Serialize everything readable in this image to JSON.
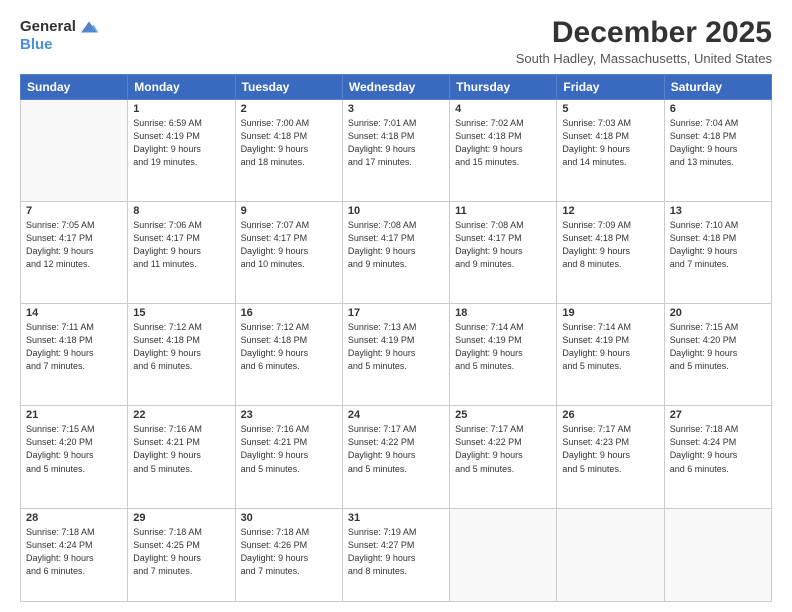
{
  "logo": {
    "line1": "General",
    "line2": "Blue"
  },
  "title": "December 2025",
  "subtitle": "South Hadley, Massachusetts, United States",
  "header_days": [
    "Sunday",
    "Monday",
    "Tuesday",
    "Wednesday",
    "Thursday",
    "Friday",
    "Saturday"
  ],
  "weeks": [
    [
      {
        "day": "",
        "info": ""
      },
      {
        "day": "1",
        "info": "Sunrise: 6:59 AM\nSunset: 4:19 PM\nDaylight: 9 hours\nand 19 minutes."
      },
      {
        "day": "2",
        "info": "Sunrise: 7:00 AM\nSunset: 4:18 PM\nDaylight: 9 hours\nand 18 minutes."
      },
      {
        "day": "3",
        "info": "Sunrise: 7:01 AM\nSunset: 4:18 PM\nDaylight: 9 hours\nand 17 minutes."
      },
      {
        "day": "4",
        "info": "Sunrise: 7:02 AM\nSunset: 4:18 PM\nDaylight: 9 hours\nand 15 minutes."
      },
      {
        "day": "5",
        "info": "Sunrise: 7:03 AM\nSunset: 4:18 PM\nDaylight: 9 hours\nand 14 minutes."
      },
      {
        "day": "6",
        "info": "Sunrise: 7:04 AM\nSunset: 4:18 PM\nDaylight: 9 hours\nand 13 minutes."
      }
    ],
    [
      {
        "day": "7",
        "info": "Sunrise: 7:05 AM\nSunset: 4:17 PM\nDaylight: 9 hours\nand 12 minutes."
      },
      {
        "day": "8",
        "info": "Sunrise: 7:06 AM\nSunset: 4:17 PM\nDaylight: 9 hours\nand 11 minutes."
      },
      {
        "day": "9",
        "info": "Sunrise: 7:07 AM\nSunset: 4:17 PM\nDaylight: 9 hours\nand 10 minutes."
      },
      {
        "day": "10",
        "info": "Sunrise: 7:08 AM\nSunset: 4:17 PM\nDaylight: 9 hours\nand 9 minutes."
      },
      {
        "day": "11",
        "info": "Sunrise: 7:08 AM\nSunset: 4:17 PM\nDaylight: 9 hours\nand 9 minutes."
      },
      {
        "day": "12",
        "info": "Sunrise: 7:09 AM\nSunset: 4:18 PM\nDaylight: 9 hours\nand 8 minutes."
      },
      {
        "day": "13",
        "info": "Sunrise: 7:10 AM\nSunset: 4:18 PM\nDaylight: 9 hours\nand 7 minutes."
      }
    ],
    [
      {
        "day": "14",
        "info": "Sunrise: 7:11 AM\nSunset: 4:18 PM\nDaylight: 9 hours\nand 7 minutes."
      },
      {
        "day": "15",
        "info": "Sunrise: 7:12 AM\nSunset: 4:18 PM\nDaylight: 9 hours\nand 6 minutes."
      },
      {
        "day": "16",
        "info": "Sunrise: 7:12 AM\nSunset: 4:18 PM\nDaylight: 9 hours\nand 6 minutes."
      },
      {
        "day": "17",
        "info": "Sunrise: 7:13 AM\nSunset: 4:19 PM\nDaylight: 9 hours\nand 5 minutes."
      },
      {
        "day": "18",
        "info": "Sunrise: 7:14 AM\nSunset: 4:19 PM\nDaylight: 9 hours\nand 5 minutes."
      },
      {
        "day": "19",
        "info": "Sunrise: 7:14 AM\nSunset: 4:19 PM\nDaylight: 9 hours\nand 5 minutes."
      },
      {
        "day": "20",
        "info": "Sunrise: 7:15 AM\nSunset: 4:20 PM\nDaylight: 9 hours\nand 5 minutes."
      }
    ],
    [
      {
        "day": "21",
        "info": "Sunrise: 7:15 AM\nSunset: 4:20 PM\nDaylight: 9 hours\nand 5 minutes."
      },
      {
        "day": "22",
        "info": "Sunrise: 7:16 AM\nSunset: 4:21 PM\nDaylight: 9 hours\nand 5 minutes."
      },
      {
        "day": "23",
        "info": "Sunrise: 7:16 AM\nSunset: 4:21 PM\nDaylight: 9 hours\nand 5 minutes."
      },
      {
        "day": "24",
        "info": "Sunrise: 7:17 AM\nSunset: 4:22 PM\nDaylight: 9 hours\nand 5 minutes."
      },
      {
        "day": "25",
        "info": "Sunrise: 7:17 AM\nSunset: 4:22 PM\nDaylight: 9 hours\nand 5 minutes."
      },
      {
        "day": "26",
        "info": "Sunrise: 7:17 AM\nSunset: 4:23 PM\nDaylight: 9 hours\nand 5 minutes."
      },
      {
        "day": "27",
        "info": "Sunrise: 7:18 AM\nSunset: 4:24 PM\nDaylight: 9 hours\nand 6 minutes."
      }
    ],
    [
      {
        "day": "28",
        "info": "Sunrise: 7:18 AM\nSunset: 4:24 PM\nDaylight: 9 hours\nand 6 minutes."
      },
      {
        "day": "29",
        "info": "Sunrise: 7:18 AM\nSunset: 4:25 PM\nDaylight: 9 hours\nand 7 minutes."
      },
      {
        "day": "30",
        "info": "Sunrise: 7:18 AM\nSunset: 4:26 PM\nDaylight: 9 hours\nand 7 minutes."
      },
      {
        "day": "31",
        "info": "Sunrise: 7:19 AM\nSunset: 4:27 PM\nDaylight: 9 hours\nand 8 minutes."
      },
      {
        "day": "",
        "info": ""
      },
      {
        "day": "",
        "info": ""
      },
      {
        "day": "",
        "info": ""
      }
    ]
  ]
}
